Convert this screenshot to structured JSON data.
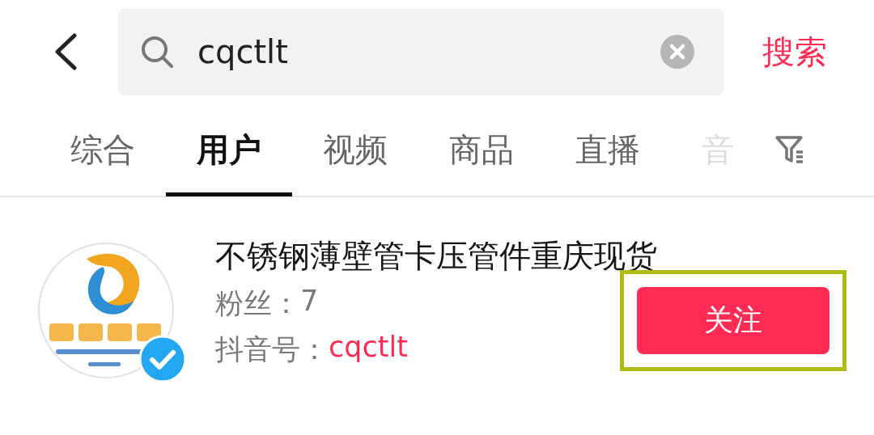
{
  "search": {
    "value": "cqctlt",
    "action": "搜索"
  },
  "tabs": [
    {
      "label": "综合",
      "selected": false,
      "faded": false
    },
    {
      "label": "用户",
      "selected": true,
      "faded": false
    },
    {
      "label": "视频",
      "selected": false,
      "faded": false
    },
    {
      "label": "商品",
      "selected": false,
      "faded": false
    },
    {
      "label": "直播",
      "selected": false,
      "faded": false
    },
    {
      "label": "音",
      "selected": false,
      "faded": true
    }
  ],
  "results": [
    {
      "name": "不锈钢薄壁管卡压管件重庆现货",
      "verified": true,
      "fans_label": "粉丝：",
      "fans": "7",
      "id_label": "抖音号：",
      "id": "cqctlt",
      "button": {
        "label": "关注",
        "highlighted": true
      }
    }
  ]
}
